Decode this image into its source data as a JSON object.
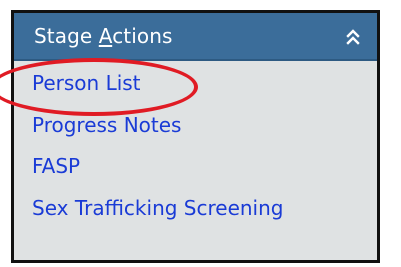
{
  "panel": {
    "title_prefix": "Stage ",
    "title_underlined": "A",
    "title_suffix": "ctions",
    "collapse_icon": "double-chevron-up-icon"
  },
  "actions": [
    {
      "label": "Person List",
      "highlighted": true
    },
    {
      "label": "Progress Notes",
      "highlighted": false
    },
    {
      "label": "FASP",
      "highlighted": false
    },
    {
      "label": "Sex Trafficking Screening",
      "highlighted": false
    }
  ],
  "colors": {
    "header_bg": "#3b6d9a",
    "panel_bg": "#dfe2e3",
    "link": "#1a3bd6",
    "highlight": "#e01b24"
  }
}
